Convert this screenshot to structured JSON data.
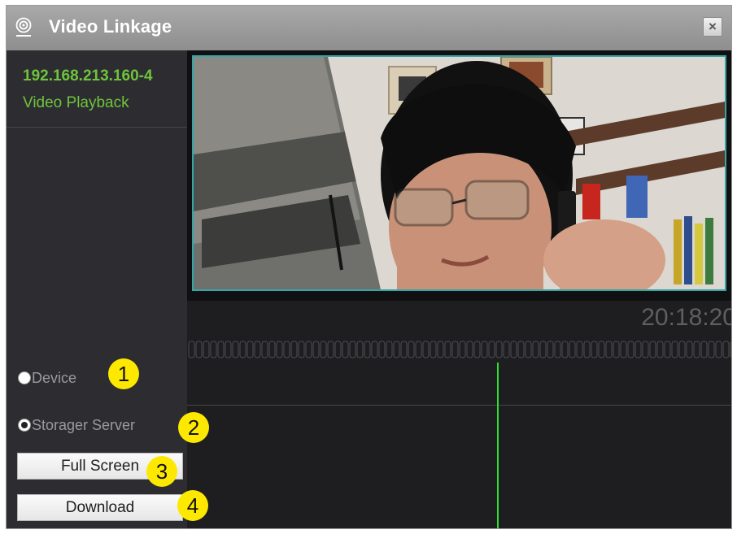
{
  "window": {
    "title": "Video Linkage",
    "close_label": "×"
  },
  "sidebar": {
    "device_name": "192.168.213.160-4",
    "mode_label": "Video Playback",
    "options": [
      {
        "label": "Device",
        "checked": false
      },
      {
        "label": "Storager Server",
        "checked": true
      }
    ],
    "full_screen_label": "Full Screen",
    "download_label": "Download"
  },
  "timeline": {
    "current_time": "20:18:20"
  },
  "annotations": [
    "1",
    "2",
    "3",
    "4"
  ],
  "colors": {
    "accent_green": "#6ec43c",
    "cursor_green": "#2ce02c",
    "frame_teal": "#36a5a5",
    "badge_yellow": "#fde900"
  }
}
